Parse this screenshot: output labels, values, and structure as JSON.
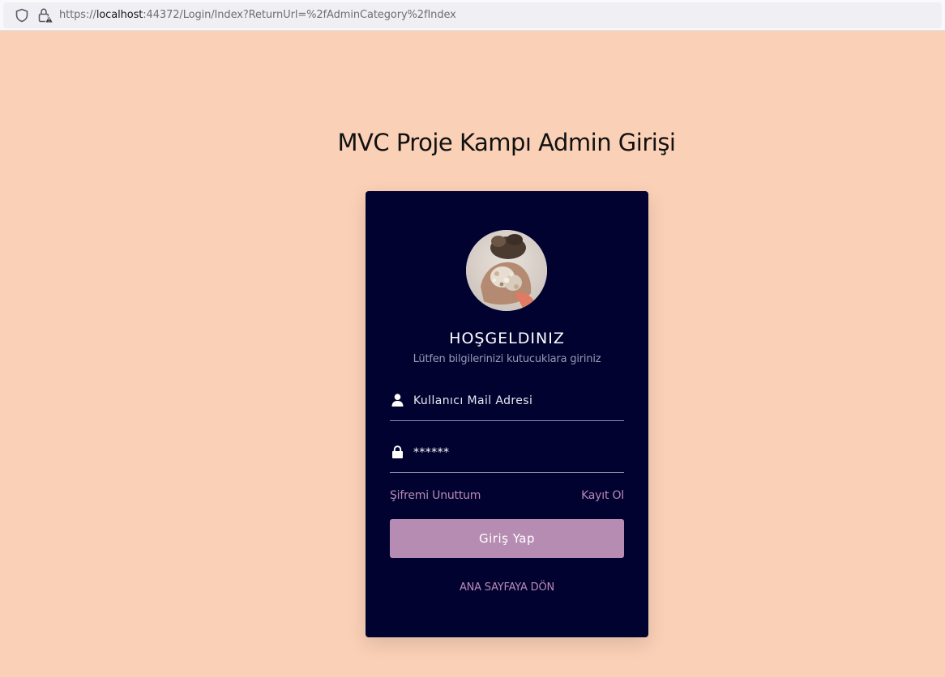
{
  "browser": {
    "url_prefix": "https://",
    "url_host": "localhost",
    "url_rest": ":44372/Login/Index?ReturnUrl=%2fAdminCategory%2fIndex",
    "icons": [
      "shield-icon",
      "lock-warning-icon"
    ]
  },
  "page": {
    "title": "MVC Proje Kampı Admin Girişi",
    "background_color": "#fad0b6"
  },
  "card": {
    "background_color": "#020231",
    "welcome": "HOŞGELDINIZ",
    "subtitle": "Lütfen bilgilerinizi kutucuklara giriniz",
    "username": {
      "icon": "user-icon",
      "placeholder": "Kullanıcı Mail Adresi",
      "value": ""
    },
    "password": {
      "icon": "lock-icon",
      "placeholder": "",
      "value": "******"
    },
    "forgot_label": "Şifremi Unuttum",
    "register_label": "Kayıt Ol",
    "login_button": "Giriş Yap",
    "home_link": "ANA SAYFAYA DÖN",
    "accent_color": "#b78cb3"
  }
}
